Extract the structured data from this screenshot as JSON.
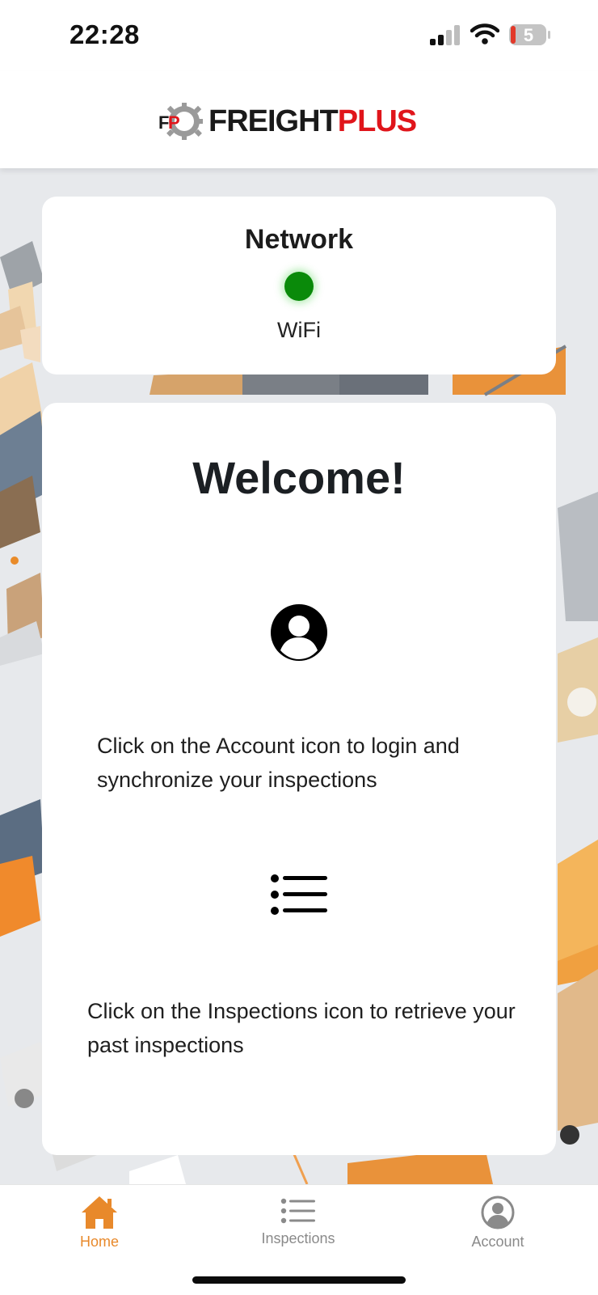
{
  "status_bar": {
    "time": "22:28",
    "battery_level": "5"
  },
  "header": {
    "logo_text_1": "FREIGHT",
    "logo_text_2": "PLUS",
    "logo_mark": "FP"
  },
  "network_card": {
    "title": "Network",
    "status_color": "#0a8a0a",
    "connection_type": "WiFi"
  },
  "welcome_card": {
    "title": "Welcome!",
    "account_icon": "account-circle-icon",
    "account_text": "Click on the Account icon to login and synchronize your inspections",
    "inspections_icon": "list-icon",
    "inspections_text": "Click on the Inspections icon to retrieve your past inspections"
  },
  "tab_bar": {
    "tabs": [
      {
        "label": "Home",
        "icon": "home-icon",
        "active": true
      },
      {
        "label": "Inspections",
        "icon": "list-icon",
        "active": false
      },
      {
        "label": "Account",
        "icon": "account-icon",
        "active": false
      }
    ],
    "active_color": "#e8892b",
    "inactive_color": "#8a8a8a"
  }
}
